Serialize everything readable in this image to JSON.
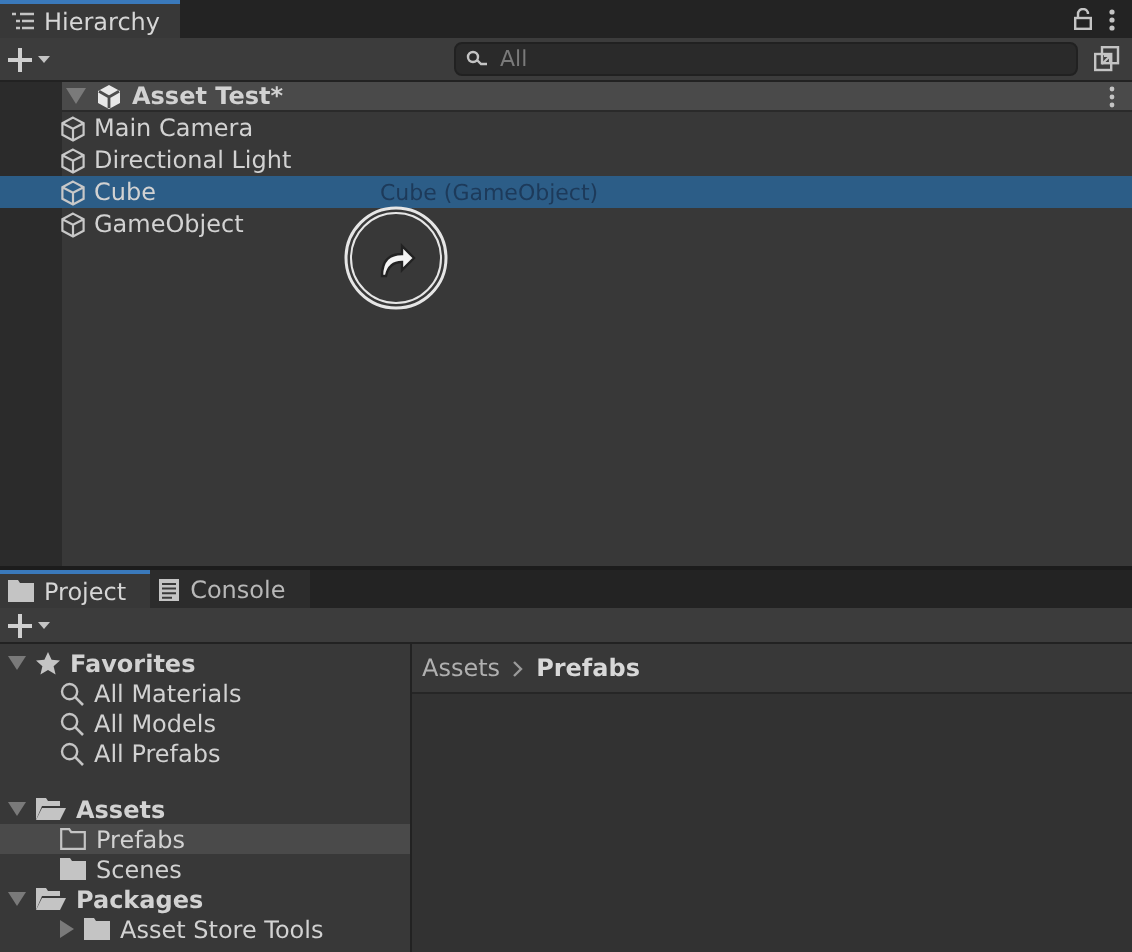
{
  "hierarchy": {
    "tab": {
      "label": "Hierarchy",
      "selected": true
    },
    "search": {
      "placeholder": "All"
    },
    "scene": {
      "label": "Asset Test*",
      "expanded": true,
      "children": [
        {
          "label": "Main Camera",
          "selected": false
        },
        {
          "label": "Directional Light",
          "selected": false
        },
        {
          "label": "Cube",
          "selected": true
        },
        {
          "label": "GameObject",
          "selected": false
        }
      ]
    },
    "drag_label": "Cube (GameObject)"
  },
  "project": {
    "tabs": [
      {
        "label": "Project",
        "selected": true,
        "kind": "folder"
      },
      {
        "label": "Console",
        "selected": false,
        "kind": "console"
      }
    ],
    "tree": [
      {
        "label": "Favorites",
        "kind": "star",
        "expanded": true,
        "children": [
          {
            "label": "All Materials",
            "kind": "search",
            "selected": false
          },
          {
            "label": "All Models",
            "kind": "search",
            "selected": false
          },
          {
            "label": "All Prefabs",
            "kind": "search",
            "selected": false
          }
        ]
      },
      {
        "label": "Assets",
        "kind": "folder-open",
        "expanded": true,
        "children": [
          {
            "label": "Prefabs",
            "kind": "folder-empty",
            "selected": true
          },
          {
            "label": "Scenes",
            "kind": "folder",
            "selected": false
          }
        ]
      },
      {
        "label": "Packages",
        "kind": "folder-open",
        "expanded": true,
        "children": [
          {
            "label": "Asset Store Tools",
            "kind": "folder",
            "selected": false,
            "expanded": false
          }
        ]
      }
    ],
    "breadcrumb": [
      "Assets",
      "Prefabs"
    ]
  }
}
